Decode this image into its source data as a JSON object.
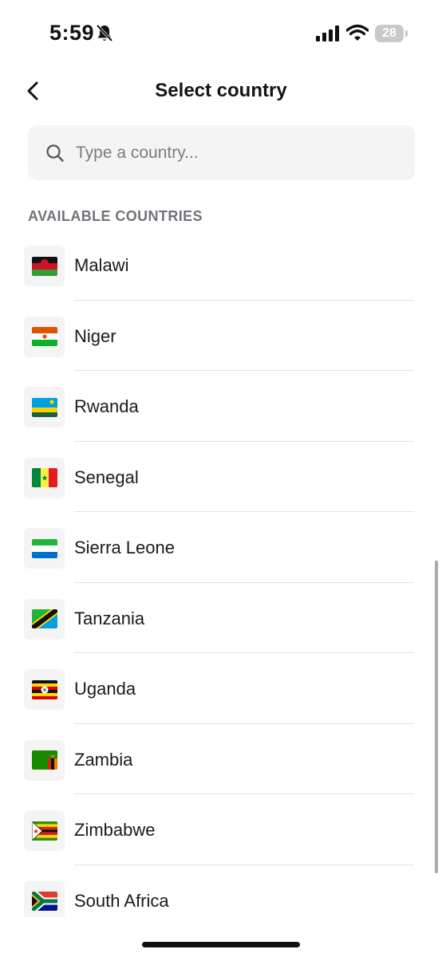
{
  "status_bar": {
    "time": "5:59",
    "battery_level": "28",
    "icons": [
      "bell-slash-icon",
      "cellular-signal-icon",
      "wifi-icon",
      "battery-icon"
    ]
  },
  "header": {
    "title": "Select country",
    "back_icon": "chevron-left-icon"
  },
  "search": {
    "placeholder": "Type a country...",
    "value": "",
    "icon": "search-icon"
  },
  "section": {
    "label": "AVAILABLE COUNTRIES"
  },
  "countries": [
    {
      "name": "Malawi",
      "flag_icon": "malawi-flag-icon"
    },
    {
      "name": "Niger",
      "flag_icon": "niger-flag-icon"
    },
    {
      "name": "Rwanda",
      "flag_icon": "rwanda-flag-icon"
    },
    {
      "name": "Senegal",
      "flag_icon": "senegal-flag-icon"
    },
    {
      "name": "Sierra Leone",
      "flag_icon": "sierra-leone-flag-icon"
    },
    {
      "name": "Tanzania",
      "flag_icon": "tanzania-flag-icon"
    },
    {
      "name": "Uganda",
      "flag_icon": "uganda-flag-icon"
    },
    {
      "name": "Zambia",
      "flag_icon": "zambia-flag-icon"
    },
    {
      "name": "Zimbabwe",
      "flag_icon": "zimbabwe-flag-icon"
    },
    {
      "name": "South Africa",
      "flag_icon": "south-africa-flag-icon"
    }
  ],
  "colors": {
    "search_background": "#f4f4f4",
    "section_label": "#6f7479",
    "divider": "#e3e3e3",
    "text": "#1a1a1a"
  }
}
